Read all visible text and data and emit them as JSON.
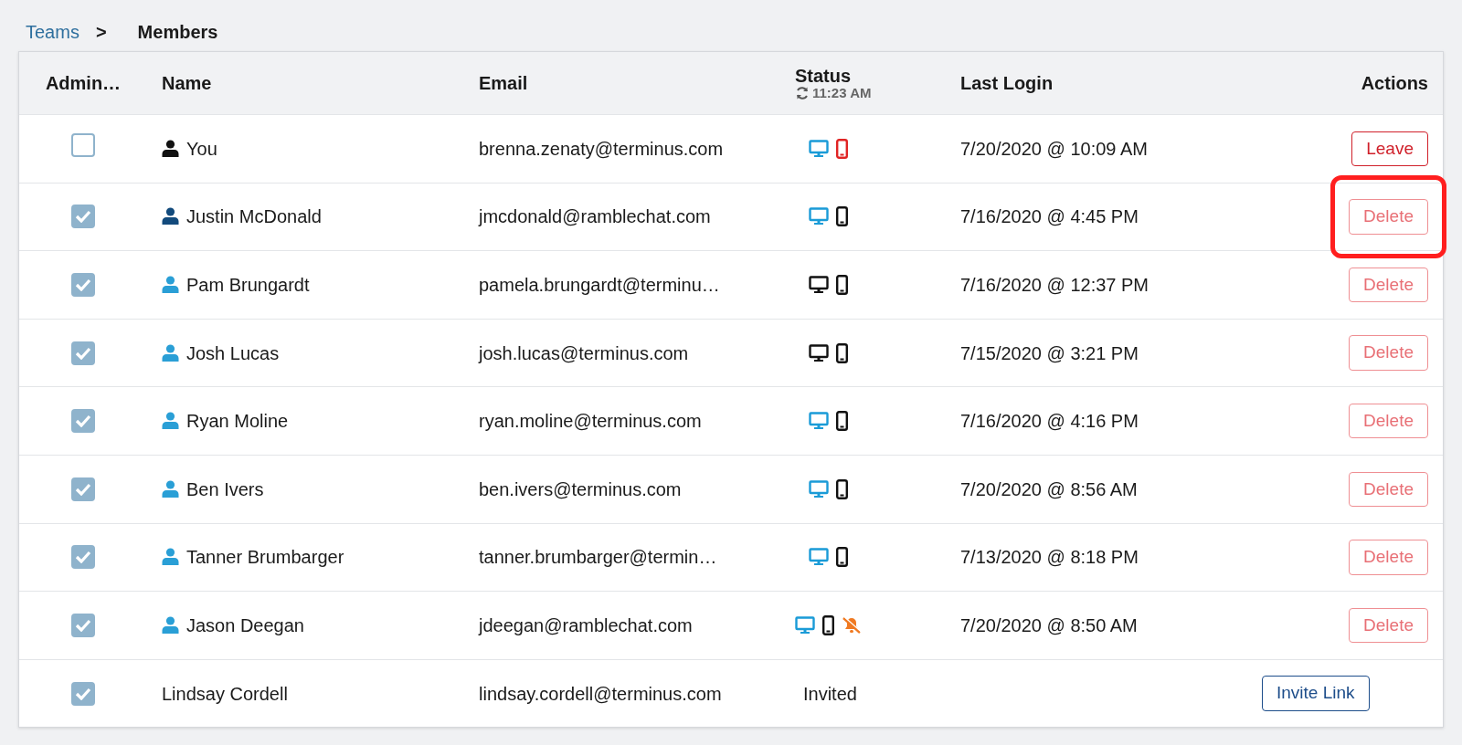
{
  "breadcrumb": [
    {
      "label": "Teams",
      "kind": "link"
    },
    {
      "label": ">",
      "kind": "separator"
    },
    {
      "label": "Members",
      "kind": "current"
    }
  ],
  "table": {
    "columns": [
      {
        "label": "Admin…"
      },
      {
        "label": "Name"
      },
      {
        "label": "Email"
      },
      {
        "label": "Status",
        "sub": "11:23 AM"
      },
      {
        "label": "Last Login"
      },
      {
        "label": "Actions"
      }
    ],
    "rows": [
      {
        "admin": false,
        "name": "You",
        "color": "#111111",
        "email": "brenna.zenaty@terminus.com",
        "devices": [
          {
            "kind": "desktop",
            "color": "#1a9bd7"
          },
          {
            "kind": "mobile",
            "color": "#e02424"
          }
        ],
        "last_login": "7/20/2020 @ 10:09 AM",
        "action": {
          "label": "Leave",
          "kind": "leave",
          "highlighted": false
        }
      },
      {
        "admin": true,
        "name": "Justin McDonald",
        "color": "#124a7c",
        "email": "jmcdonald@ramblechat.com",
        "devices": [
          {
            "kind": "desktop",
            "color": "#1a9bd7"
          },
          {
            "kind": "mobile",
            "color": "#111111"
          }
        ],
        "last_login": "7/16/2020 @ 4:45 PM",
        "action": {
          "label": "Delete",
          "kind": "delete",
          "highlighted": true
        }
      },
      {
        "admin": true,
        "name": "Pam Brungardt",
        "color": "#2a9fd6",
        "email": "pamela.brungardt@terminu…",
        "devices": [
          {
            "kind": "desktop",
            "color": "#111111"
          },
          {
            "kind": "mobile",
            "color": "#111111"
          }
        ],
        "last_login": "7/16/2020 @ 12:37 PM",
        "action": {
          "label": "Delete",
          "kind": "delete",
          "highlighted": false
        }
      },
      {
        "admin": true,
        "name": "Josh Lucas",
        "color": "#2a9fd6",
        "email": "josh.lucas@terminus.com",
        "devices": [
          {
            "kind": "desktop",
            "color": "#111111"
          },
          {
            "kind": "mobile",
            "color": "#111111"
          }
        ],
        "last_login": "7/15/2020 @ 3:21 PM",
        "action": {
          "label": "Delete",
          "kind": "delete",
          "highlighted": false
        }
      },
      {
        "admin": true,
        "name": "Ryan Moline",
        "color": "#2a9fd6",
        "email": "ryan.moline@terminus.com",
        "devices": [
          {
            "kind": "desktop",
            "color": "#1a9bd7"
          },
          {
            "kind": "mobile",
            "color": "#111111"
          }
        ],
        "last_login": "7/16/2020 @ 4:16 PM",
        "action": {
          "label": "Delete",
          "kind": "delete",
          "highlighted": false
        }
      },
      {
        "admin": true,
        "name": "Ben Ivers",
        "color": "#2a9fd6",
        "email": "ben.ivers@terminus.com",
        "devices": [
          {
            "kind": "desktop",
            "color": "#1a9bd7"
          },
          {
            "kind": "mobile",
            "color": "#111111"
          }
        ],
        "last_login": "7/20/2020 @ 8:56 AM",
        "action": {
          "label": "Delete",
          "kind": "delete",
          "highlighted": false
        }
      },
      {
        "admin": true,
        "name": "Tanner Brumbarger",
        "color": "#2a9fd6",
        "email": "tanner.brumbarger@termin…",
        "devices": [
          {
            "kind": "desktop",
            "color": "#1a9bd7"
          },
          {
            "kind": "mobile",
            "color": "#111111"
          }
        ],
        "last_login": "7/13/2020 @ 8:18 PM",
        "action": {
          "label": "Delete",
          "kind": "delete",
          "highlighted": false
        }
      },
      {
        "admin": true,
        "name": "Jason Deegan",
        "color": "#2a9fd6",
        "email": "jdeegan@ramblechat.com",
        "devices": [
          {
            "kind": "desktop",
            "color": "#1a9bd7"
          },
          {
            "kind": "mobile",
            "color": "#111111"
          },
          {
            "kind": "muted",
            "color": "#f07a22"
          }
        ],
        "last_login": "7/20/2020 @ 8:50 AM",
        "action": {
          "label": "Delete",
          "kind": "delete",
          "highlighted": false
        }
      },
      {
        "admin": true,
        "name": "Lindsay Cordell",
        "email": "lindsay.cordell@terminus.com",
        "status": "Invited",
        "action": {
          "label": "Invite Link",
          "kind": "invite",
          "highlighted": false
        }
      }
    ]
  }
}
